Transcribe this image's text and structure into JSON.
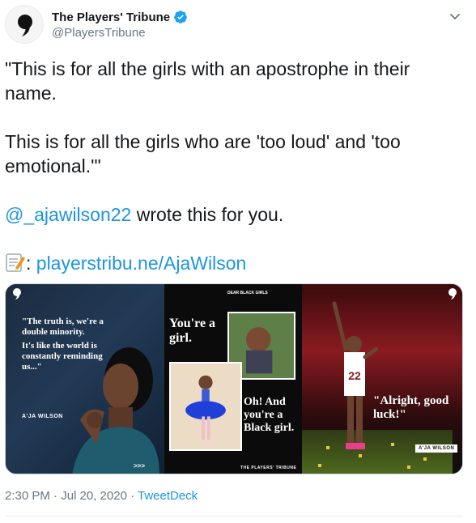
{
  "author": {
    "display_name": "The Players' Tribune",
    "handle": "@PlayersTribune",
    "verified": true,
    "avatar_icon": "comma-logo-icon"
  },
  "tweet": {
    "line1": "\"This is for all the girls with an apostrophe in their name.",
    "line2": "This is for all the girls who are 'too loud' and 'too emotional.'\"",
    "mention": "@_ajawilson22",
    "mention_suffix": " wrote this for you.",
    "link_prefix": ": ",
    "link": "playerstribu.ne/AjaWilson",
    "link_icon": "memo-icon"
  },
  "media": {
    "quote_left": [
      "\"The truth is, we're a double minority.",
      "It's like the world is constantly reminding us...\""
    ],
    "name_left": "A'JA WILSON",
    "arrows": ">>>",
    "dear_title": "DEAR BLACK GIRLS",
    "youre_a_girl": "You're a girl.",
    "oh_and": [
      "Oh! And",
      "you're a",
      "Black girl."
    ],
    "footer_brand": "THE PLAYERS' TRIBUNE",
    "alright": "\"Alright, good luck!\"",
    "name_right": "A'JA WILSON",
    "jersey_number": "22"
  },
  "meta": {
    "time": "2:30 PM · Jul 20, 2020 · ",
    "source": "TweetDeck"
  },
  "colors": {
    "link": "#1b95e0",
    "muted": "#657786",
    "verified": "#1da1f2"
  }
}
